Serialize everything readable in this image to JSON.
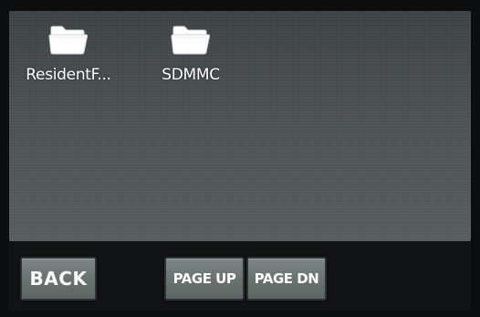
{
  "file_browser": {
    "items": [
      {
        "label": "ResidentF...",
        "icon": "folder-icon"
      },
      {
        "label": "SDMMC",
        "icon": "folder-icon"
      }
    ]
  },
  "toolbar": {
    "back_label": "BACK",
    "page_up_label": "PAGE UP",
    "page_dn_label": "PAGE DN"
  },
  "colors": {
    "pane_background": "#4a4f52",
    "button_face": "#6f7877",
    "text": "#ffffff",
    "folder_icon": "#ffffff"
  }
}
